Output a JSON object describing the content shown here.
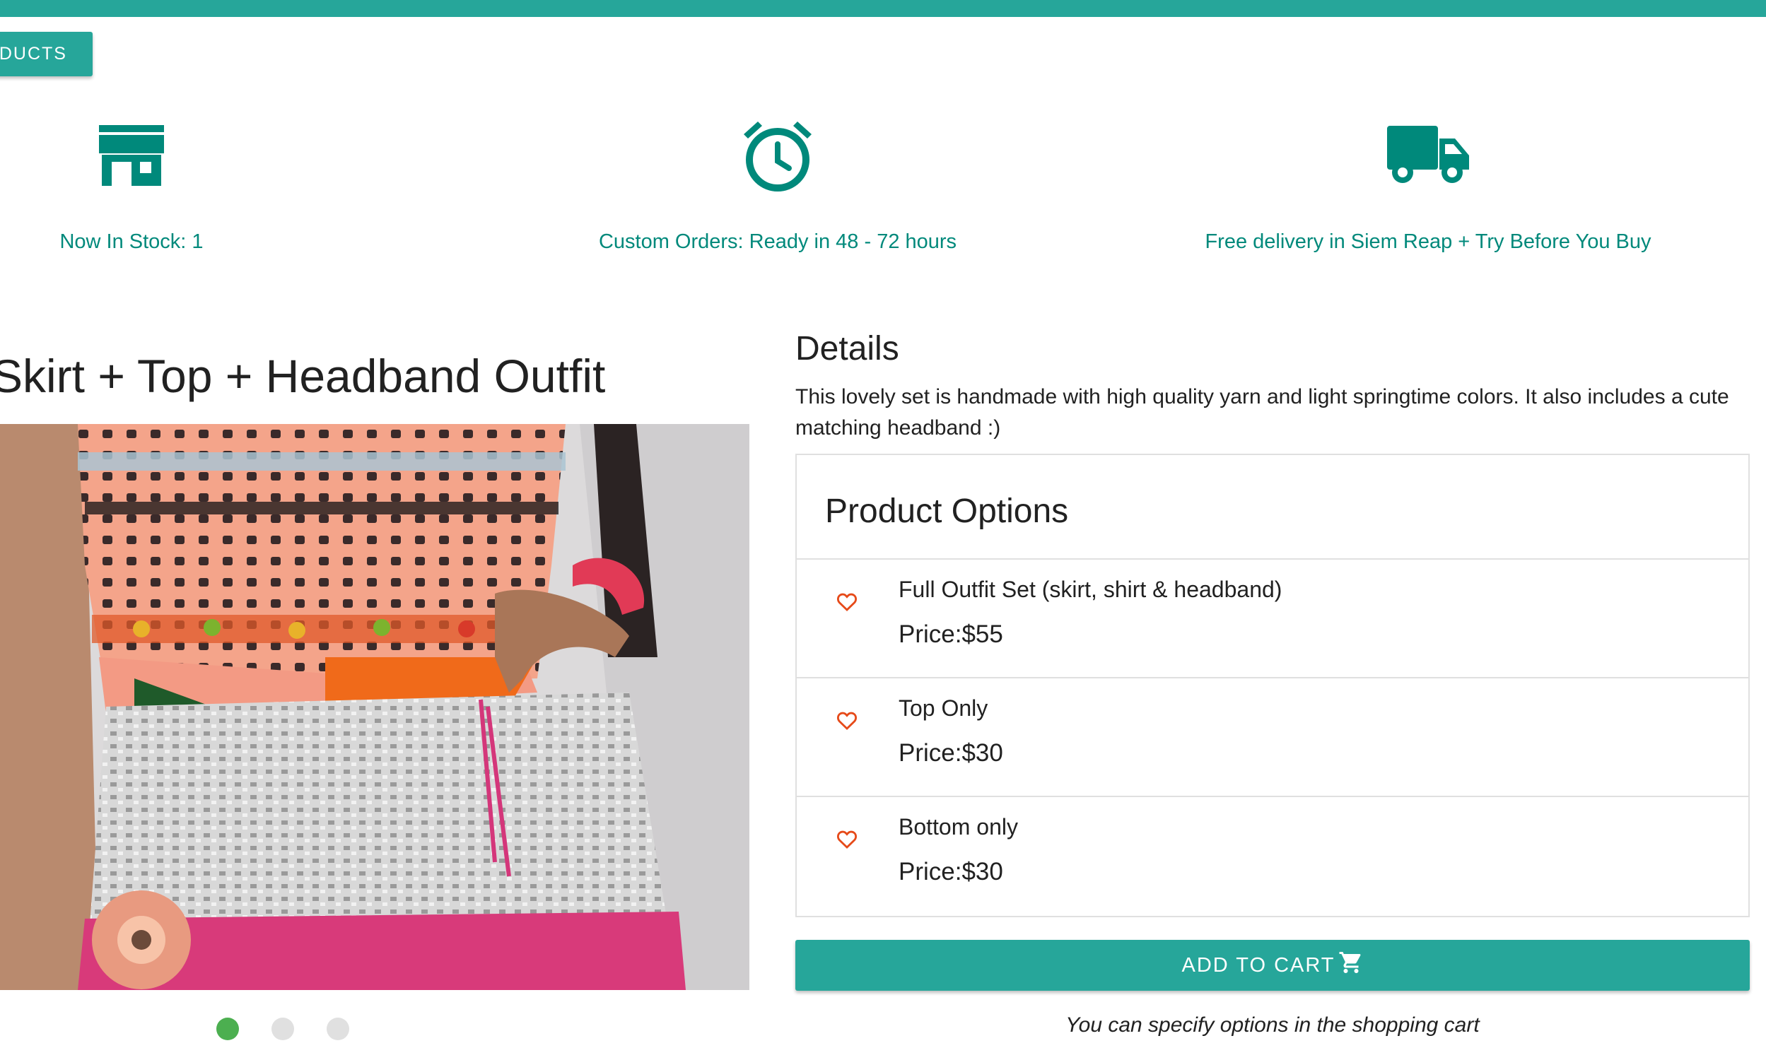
{
  "nav": {
    "back_label": "PRODUCTS"
  },
  "features": [
    {
      "icon": "store-icon",
      "text": "Now In Stock: 1"
    },
    {
      "icon": "alarm-clock-icon",
      "text": "Custom Orders: Ready in 48 - 72 hours"
    },
    {
      "icon": "delivery-truck-icon",
      "text": "Free delivery in Siem Reap + Try Before You Buy"
    }
  ],
  "product": {
    "title": "Skirt + Top + Headband Outfit",
    "carousel": {
      "slide_count": 3,
      "active_index": 0
    }
  },
  "details": {
    "heading": "Details",
    "description": "This lovely set is handmade with high quality yarn and light springtime colors. It also includes a cute matching headband :)"
  },
  "options": {
    "heading": "Product Options",
    "items": [
      {
        "name": "Full Outfit Set (skirt, shirt & headband)",
        "price": "Price:$55"
      },
      {
        "name": "Top Only",
        "price": "Price:$30"
      },
      {
        "name": "Bottom only",
        "price": "Price:$30"
      }
    ]
  },
  "cart": {
    "button_label": "ADD TO CART",
    "note": "You can specify options in the shopping cart"
  },
  "colors": {
    "accent": "#26a69a",
    "accent_text": "#00897b",
    "heart": "#e64a19",
    "dot_active": "#4caf50",
    "dot_inactive": "#e0e0e0"
  }
}
